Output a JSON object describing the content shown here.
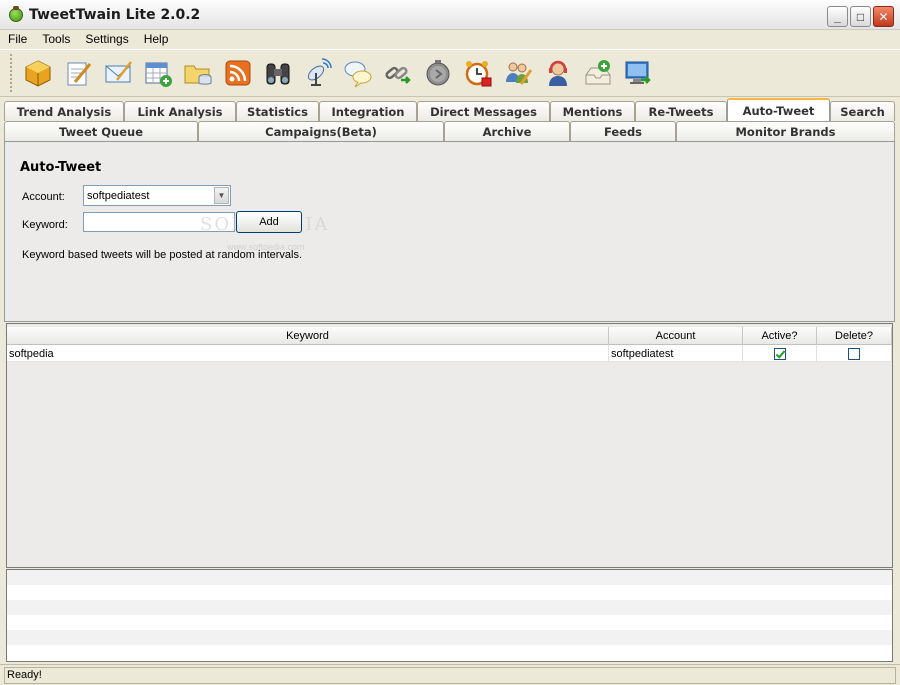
{
  "window": {
    "title": "TweetTwain Lite 2.0.2",
    "minimize": "_",
    "maximize": "□",
    "close": "✕"
  },
  "menu": [
    "File",
    "Tools",
    "Settings",
    "Help"
  ],
  "toolbar": [
    "package-icon",
    "compose-icon",
    "mail-icon",
    "calendar-icon",
    "folder-database-icon",
    "rss-icon",
    "binoculars-icon",
    "satellite-icon",
    "chat-bubbles-icon",
    "link-icon",
    "timer-icon",
    "alarm-clock-icon",
    "users-edit-icon",
    "support-agent-icon",
    "import-icon",
    "monitor-export-icon"
  ],
  "tabs_row1": [
    "Trend Analysis",
    "Link Analysis",
    "Statistics",
    "Integration",
    "Direct Messages",
    "Mentions",
    "Re-Tweets",
    "Auto-Tweet",
    "Search"
  ],
  "tabs_row2": [
    "Tweet Queue",
    "Campaigns(Beta)",
    "Archive",
    "Feeds",
    "Monitor Brands"
  ],
  "autotweet": {
    "title": "Auto-Tweet",
    "account_label": "Account:",
    "account_value": "softpediatest",
    "keyword_label": "Keyword:",
    "keyword_value": "",
    "add_label": "Add",
    "info": "Keyword based tweets will be posted at random intervals.",
    "watermark": "SOFTPEDIA",
    "watermark_sub": "www.softpedia.com"
  },
  "table": {
    "headers": [
      "Keyword",
      "Account",
      "Active?",
      "Delete?"
    ],
    "rows": [
      {
        "keyword": "softpedia",
        "account": "softpediatest",
        "active": true,
        "delete": false
      }
    ]
  },
  "status": "Ready!"
}
